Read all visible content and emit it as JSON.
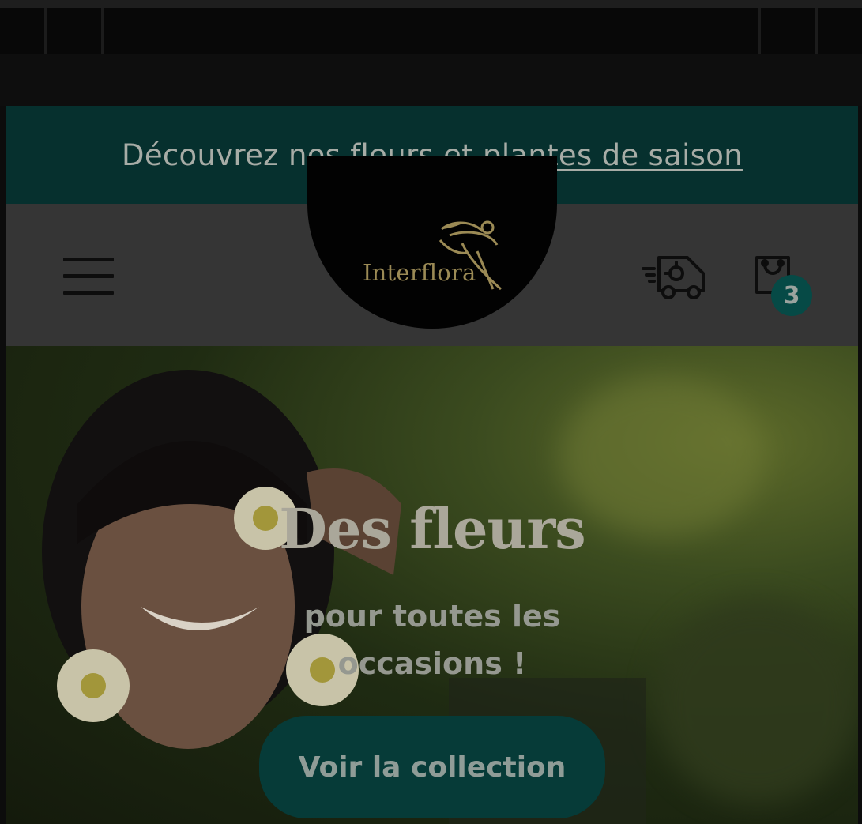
{
  "promo": {
    "prefix": "Découvrez nos",
    "link": "fleurs et plantes de saison"
  },
  "header": {
    "logo_text": "Interflora",
    "cart_count": "3"
  },
  "hero": {
    "title": "Des fleurs",
    "subtitle_line1": "pour toutes les",
    "subtitle_line2": "occasions !",
    "cta_label": "Voir la collection"
  },
  "colors": {
    "promo_bg": "#06302e",
    "brand_teal": "#064a46",
    "header_bg": "#353535"
  },
  "icons": [
    "menu-icon",
    "delivery-truck-icon",
    "shopping-bag-icon",
    "interflora-logo"
  ]
}
